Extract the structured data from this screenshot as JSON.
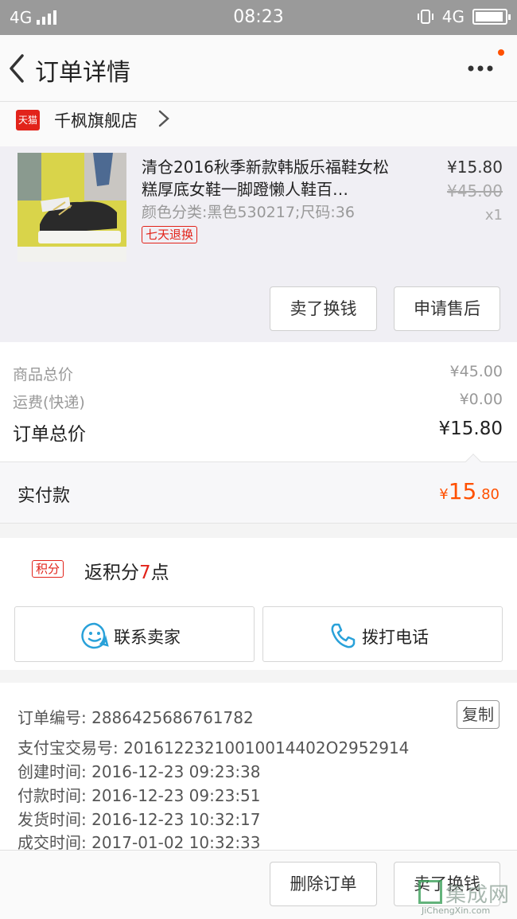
{
  "status_bar": {
    "network": "4G",
    "time": "08:23",
    "network_right": "4G"
  },
  "nav": {
    "title": "订单详情"
  },
  "shop": {
    "badge": "天猫",
    "name": "千枫旗舰店"
  },
  "item": {
    "title": "清仓2016秋季新款韩版乐福鞋女松糕厚底女鞋一脚蹬懒人鞋百…",
    "spec": "颜色分类:黑色530217;尺码:36",
    "tag": "七天退换",
    "price": "¥15.80",
    "original_price": "¥45.00",
    "quantity": "x1",
    "btn_exchange": "卖了换钱",
    "btn_aftersale": "申请售后"
  },
  "totals": {
    "goods_label": "商品总价",
    "goods_value": "¥45.00",
    "shipping_label": "运费(快递)",
    "shipping_value": "¥0.00",
    "order_label": "订单总价",
    "order_value": "¥15.80"
  },
  "paid": {
    "label": "实付款",
    "currency": "¥",
    "integer": "15",
    "decimal": ".80"
  },
  "points": {
    "tag": "积分",
    "text_prefix": "返积分",
    "value": "7",
    "text_suffix": "点"
  },
  "contact": {
    "seller": "联系卖家",
    "call": "拨打电话"
  },
  "order_info": {
    "copy": "复制",
    "rows": [
      "订单编号: 2886425686761782",
      "支付宝交易号: 20161223210010014402O2952914",
      "创建时间: 2016-12-23 09:23:38",
      "付款时间: 2016-12-23 09:23:51",
      "发货时间: 2016-12-23 10:32:17",
      "成交时间: 2017-01-02 10:32:33"
    ]
  },
  "bottom": {
    "delete": "删除订单",
    "exchange": "卖了换钱"
  },
  "watermark": {
    "text": "集成网",
    "url": "JiChengXin.com"
  },
  "colors": {
    "accent": "#ff5000",
    "tmall_red": "#e2231a",
    "icon_blue": "#29a1d9"
  }
}
